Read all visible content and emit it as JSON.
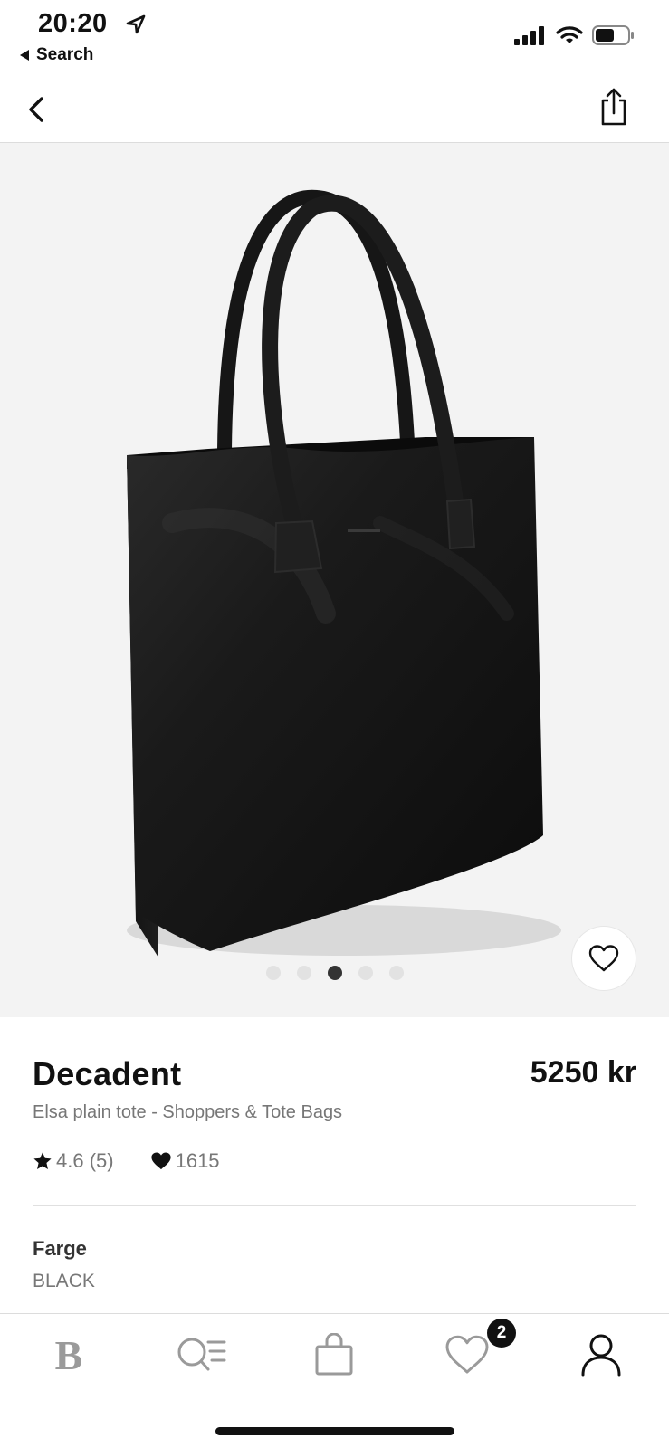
{
  "status_bar": {
    "time": "20:20",
    "back_app_label": "Search",
    "icons": [
      "location-arrow-icon",
      "signal-icon",
      "wifi-icon",
      "battery-icon"
    ]
  },
  "nav": {
    "icons": [
      "chevron-left-icon",
      "share-icon"
    ]
  },
  "gallery": {
    "image_count": 5,
    "active_index": 2,
    "favorite_icon": "heart-outline-icon"
  },
  "product": {
    "brand": "Decadent",
    "price": "5250 kr",
    "subtitle": "Elsa plain tote - Shoppers & Tote Bags",
    "rating": "4.6 (5)",
    "likes": "1615",
    "color_label": "Farge",
    "color_value": "BLACK"
  },
  "tab_bar": {
    "logo": "B",
    "wishlist_badge": "2",
    "icons": [
      "home-logo",
      "search-menu-icon",
      "bag-icon",
      "heart-icon",
      "profile-icon"
    ]
  },
  "colors": {
    "gallery_bg": "#f3f3f3",
    "text_primary": "#111111",
    "text_secondary": "#777777",
    "tab_icon": "#9a9a9a"
  }
}
